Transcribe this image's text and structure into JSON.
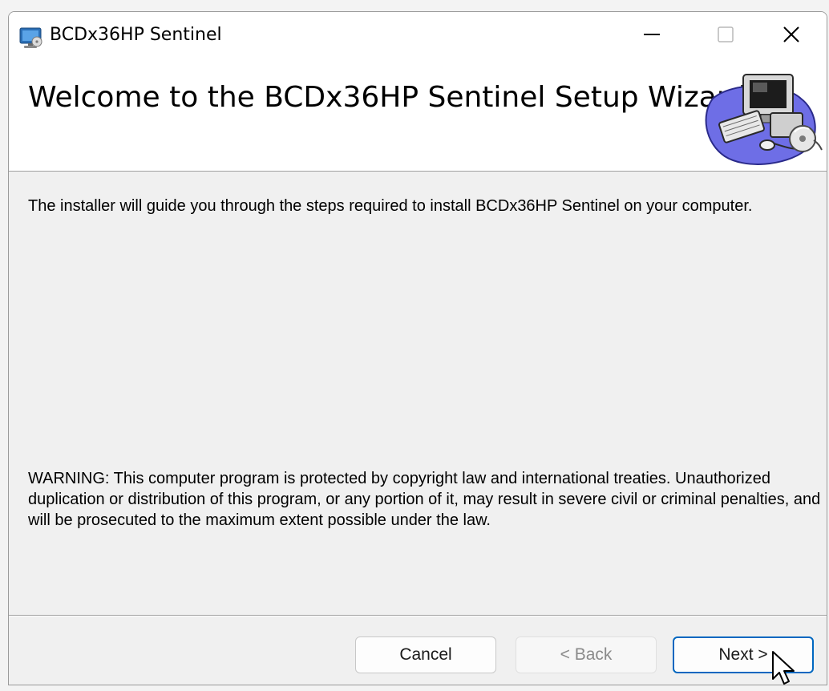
{
  "window": {
    "title": "BCDx36HP Sentinel",
    "app_icon": "installer-icon",
    "controls": {
      "minimize_icon": "minimize-icon",
      "maximize_icon": "maximize-icon",
      "close_icon": "close-icon"
    }
  },
  "header": {
    "title": "Welcome to the BCDx36HP Sentinel Setup Wizard",
    "art": "computer-setup-icon"
  },
  "body": {
    "intro": "The installer will guide you through the steps required to install BCDx36HP Sentinel on your computer.",
    "warning": "WARNING: This computer program is protected by copyright law and international treaties. Unauthorized duplication or distribution of this program, or any portion of it, may result in severe civil or criminal penalties, and will be prosecuted to the maximum extent possible under the law."
  },
  "footer": {
    "cancel_label": "Cancel",
    "back_label": "< Back",
    "next_label": "Next >"
  },
  "colors": {
    "accent": "#0067c0",
    "disabled_text": "#8a8a8a",
    "background": "#f0f0f0"
  }
}
